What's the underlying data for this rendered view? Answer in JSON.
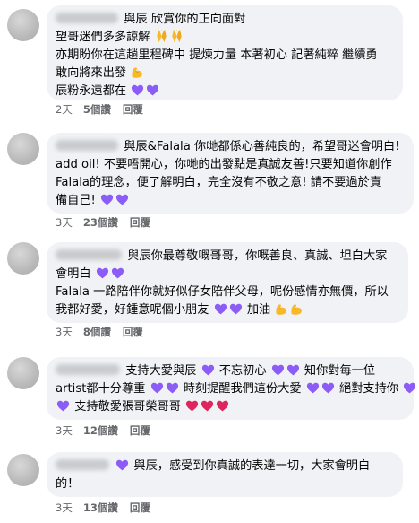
{
  "comments": [
    {
      "lines": [
        "與辰 欣賞你的正向面對",
        "望哥迷們多多諒解",
        "亦期盼你在這趟里程碑中 提煉力量 本著初心 記著純粹 繼續勇",
        "敢向將來出發",
        "辰粉永遠都在"
      ],
      "time": "2天",
      "views": "5個讚",
      "reply": "回覆"
    },
    {
      "lines": [
        "與辰&Falala 你哋都係心善純良的，希望哥迷會明白!",
        "add oil! 不要唔開心，你哋的出發點是真誠友善!只要知道你創作",
        "Falala的理念，便了解明白，完全沒有不敬之意! 請不要過於責",
        "備自己!"
      ],
      "time": "3天",
      "views": "23個讚",
      "reply": "回覆"
    },
    {
      "lines": [
        "與辰你最尊敬嘅哥哥，你嘅善良、真誠、坦白大家",
        "會明白",
        "Falala 一路陪伴你就好似仔女陪伴父母，呢份感情亦無價，所以",
        "我都好愛，好鍾意呢個小朋友",
        "加油"
      ],
      "time": "3天",
      "views": "8個讚",
      "reply": "回覆"
    },
    {
      "lines": [
        "支持大愛與辰",
        "不忘初心",
        "知你對每一位",
        "artist都十分尊重",
        "時刻提醒我們這份大愛",
        "絕對支持你",
        "支持敬愛張哥榮哥哥"
      ],
      "time": "3天",
      "views": "12個讚",
      "reply": "回覆"
    },
    {
      "lines": [
        "與辰，感受到你真誠的表達一切，大家會明白",
        "的！"
      ],
      "time": "3天",
      "views": "13個讚",
      "reply": "回覆"
    }
  ],
  "colors": {
    "bubble": "#f0f2f5",
    "meta_text": "#65676b",
    "purple_heart": "#8b5cf6",
    "red_heart": "#e0245e",
    "emoji_yellow": "#f7b928"
  }
}
